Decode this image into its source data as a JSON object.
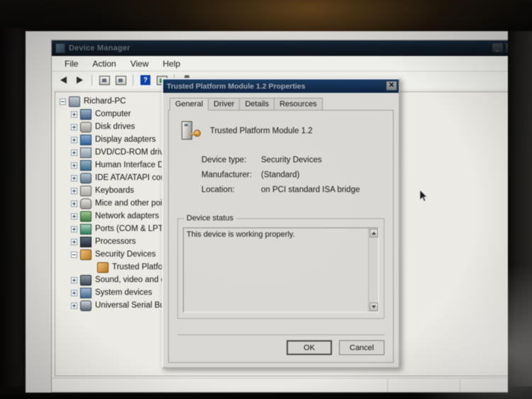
{
  "device_manager": {
    "title": "Device Manager",
    "window_buttons": {
      "minimize": "_",
      "maximize": "□",
      "close": "✕"
    },
    "menu": [
      "File",
      "Action",
      "View",
      "Help"
    ],
    "toolbar_icons": [
      "back-arrow-icon",
      "forward-arrow-icon",
      "properties-icon",
      "show-hidden-devices-icon",
      "help-icon",
      "update-driver-icon",
      "scan-hardware-icon"
    ],
    "tree": [
      {
        "label": "Richard-PC",
        "level": 0,
        "expander": "minus",
        "icon": "computer-root-icon"
      },
      {
        "label": "Computer",
        "level": 1,
        "expander": "plus",
        "icon": "computer-icon"
      },
      {
        "label": "Disk drives",
        "level": 1,
        "expander": "plus",
        "icon": "disk-drive-icon"
      },
      {
        "label": "Display adapters",
        "level": 1,
        "expander": "plus",
        "icon": "display-adapter-icon"
      },
      {
        "label": "DVD/CD-ROM drives",
        "level": 1,
        "expander": "plus",
        "icon": "dvd-drive-icon"
      },
      {
        "label": "Human Interface Devic",
        "level": 1,
        "expander": "plus",
        "icon": "hid-icon"
      },
      {
        "label": "IDE ATA/ATAPI contro",
        "level": 1,
        "expander": "plus",
        "icon": "ide-controller-icon"
      },
      {
        "label": "Keyboards",
        "level": 1,
        "expander": "plus",
        "icon": "keyboard-icon"
      },
      {
        "label": "Mice and other pointin",
        "level": 1,
        "expander": "plus",
        "icon": "mouse-icon"
      },
      {
        "label": "Network adapters",
        "level": 1,
        "expander": "plus",
        "icon": "network-adapter-icon"
      },
      {
        "label": "Ports (COM & LPT)",
        "level": 1,
        "expander": "plus",
        "icon": "port-icon"
      },
      {
        "label": "Processors",
        "level": 1,
        "expander": "plus",
        "icon": "processor-icon"
      },
      {
        "label": "Security Devices",
        "level": 1,
        "expander": "minus",
        "icon": "security-device-icon"
      },
      {
        "label": "Trusted Platform M",
        "level": 2,
        "expander": "none",
        "icon": "tpm-icon"
      },
      {
        "label": "Sound, video and gam",
        "level": 1,
        "expander": "plus",
        "icon": "sound-device-icon"
      },
      {
        "label": "System devices",
        "level": 1,
        "expander": "plus",
        "icon": "system-device-icon"
      },
      {
        "label": "Universal Serial Bus co",
        "level": 1,
        "expander": "plus",
        "icon": "usb-controller-icon"
      }
    ]
  },
  "dialog": {
    "title": "Trusted Platform Module 1.2 Properties",
    "close_label": "✕",
    "tabs": [
      {
        "label": "General",
        "active": true
      },
      {
        "label": "Driver",
        "active": false
      },
      {
        "label": "Details",
        "active": false
      },
      {
        "label": "Resources",
        "active": false
      }
    ],
    "device_name": "Trusted Platform Module 1.2",
    "device_icon": "tpm-device-icon",
    "properties": [
      {
        "label": "Device type:",
        "value": "Security Devices"
      },
      {
        "label": "Manufacturer:",
        "value": "(Standard)"
      },
      {
        "label": "Location:",
        "value": "on PCI standard ISA bridge"
      }
    ],
    "status_group_label": "Device status",
    "status_text": "This device is working properly.",
    "buttons": [
      {
        "label": "OK",
        "default": true
      },
      {
        "label": "Cancel",
        "default": false
      }
    ]
  },
  "colors": {
    "dialog_title_bar": "#14396a",
    "dm_title_bar": "#1d3147",
    "dialog_face": "#d9d8d4",
    "window_face": "#e9e8e4",
    "bezel": "#0b0a09"
  }
}
